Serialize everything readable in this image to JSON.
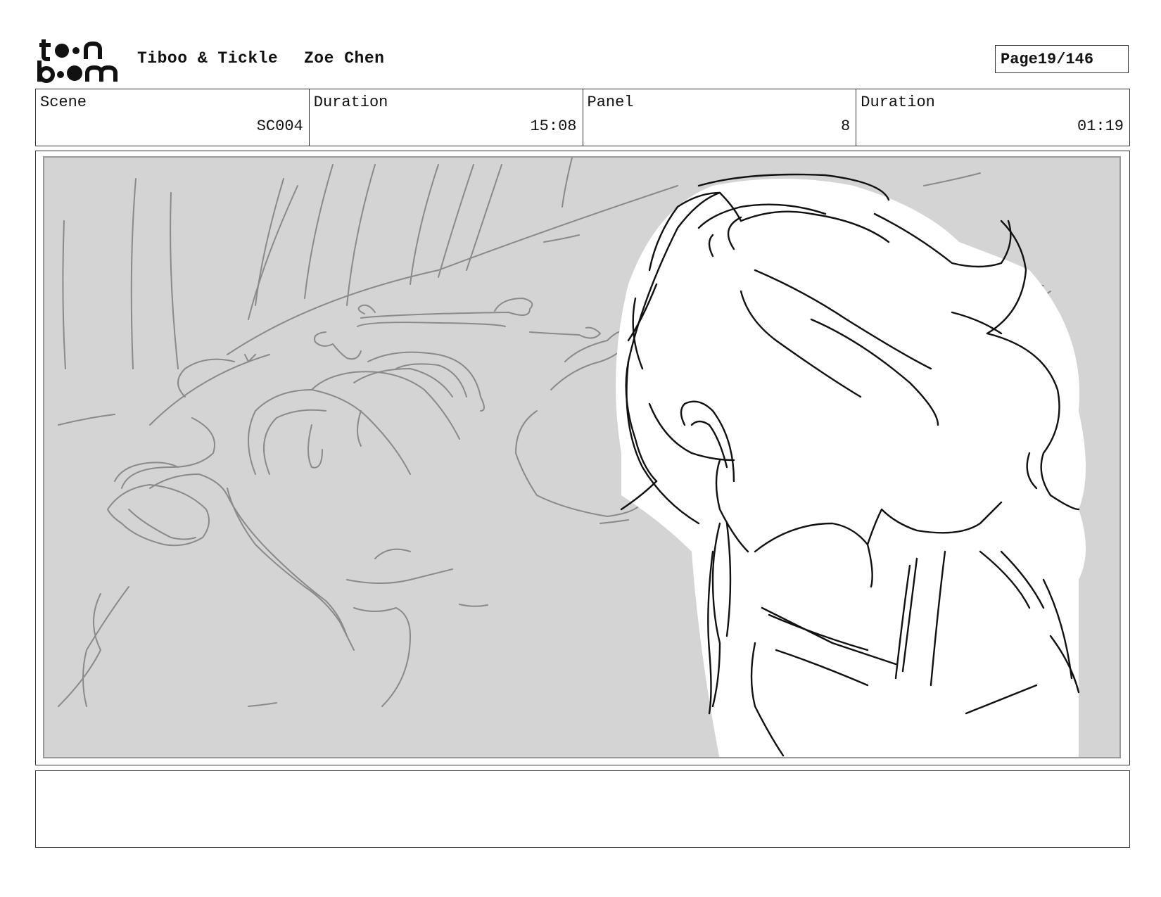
{
  "header": {
    "logo_alt": "toon boom",
    "project": "Tiboo & Tickle",
    "author": "Zoe Chen",
    "page_label": "Page",
    "page_value": "19/146"
  },
  "info": [
    {
      "label": "Scene",
      "value": "SC004"
    },
    {
      "label": "Duration",
      "value": "15:08"
    },
    {
      "label": "Panel",
      "value": "8"
    },
    {
      "label": "Duration",
      "value": "01:19"
    }
  ],
  "notes": {
    "text": ""
  }
}
